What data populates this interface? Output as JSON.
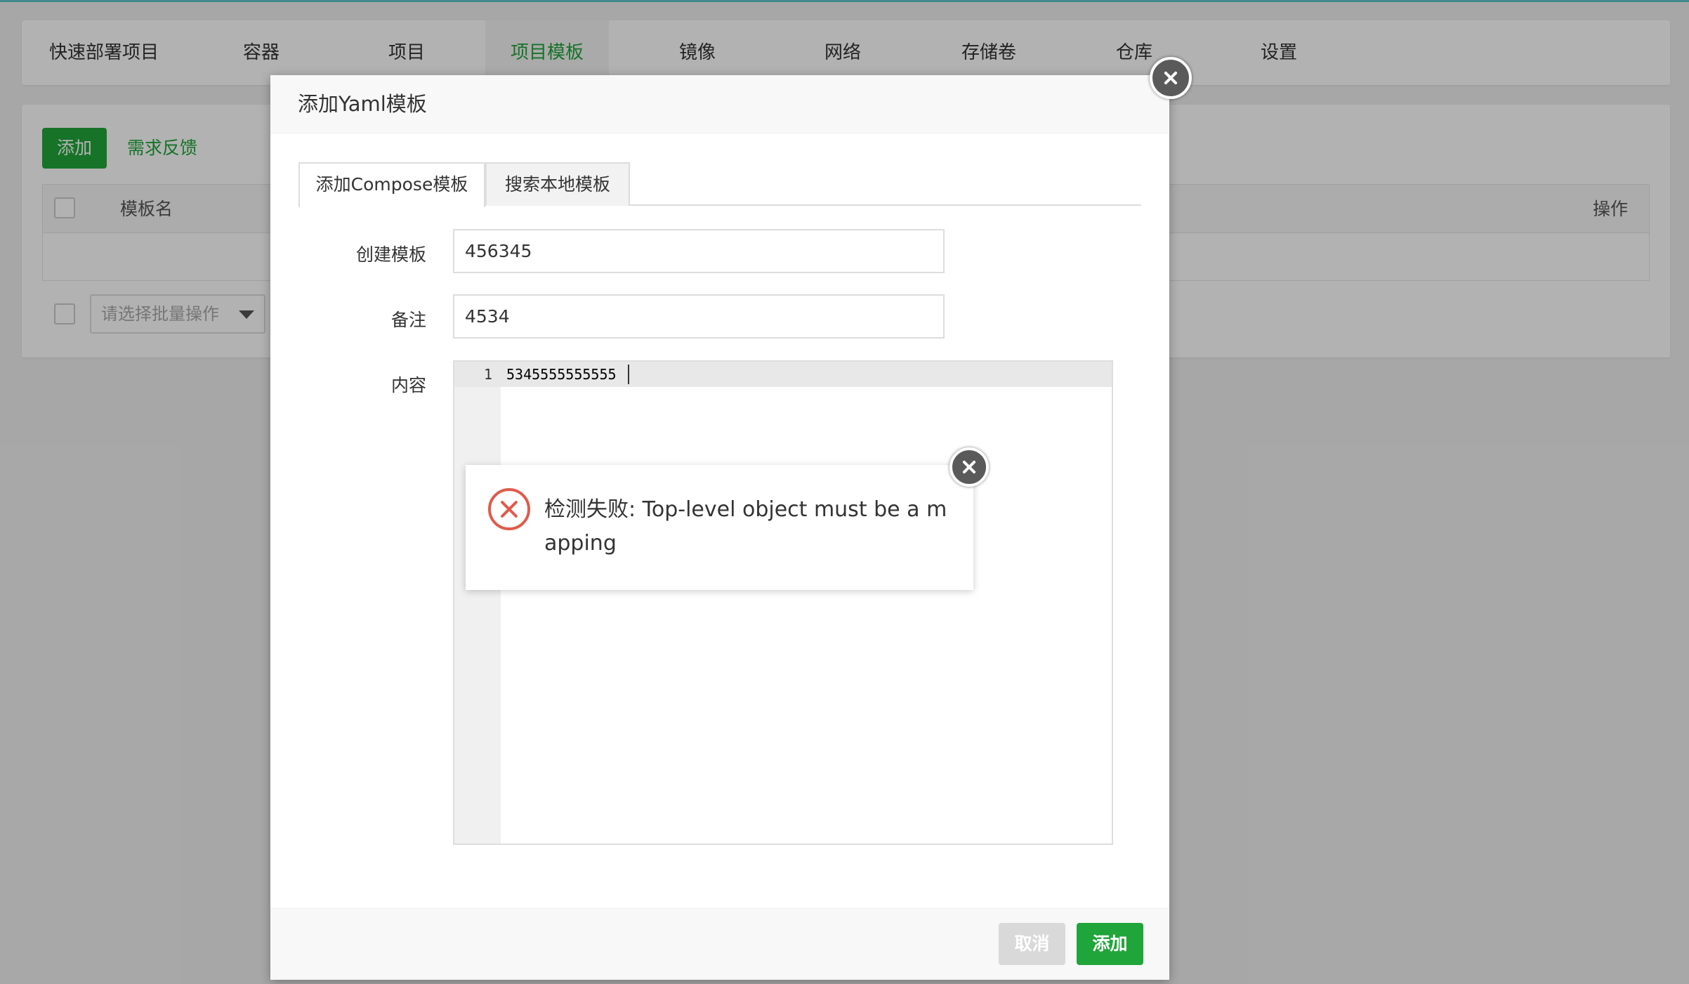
{
  "nav": {
    "items": [
      {
        "label": "快速部署项目"
      },
      {
        "label": "容器"
      },
      {
        "label": "项目"
      },
      {
        "label": "项目模板",
        "active": true
      },
      {
        "label": "镜像"
      },
      {
        "label": "网络"
      },
      {
        "label": "存储卷"
      },
      {
        "label": "仓库"
      },
      {
        "label": "设置"
      }
    ]
  },
  "toolbar": {
    "add_label": "添加",
    "feedback_label": "需求反馈"
  },
  "table": {
    "columns": [
      "模板名",
      "操作"
    ]
  },
  "batch": {
    "placeholder": "请选择批量操作"
  },
  "modal": {
    "title": "添加Yaml模板",
    "tabs": [
      {
        "label": "添加Compose模板",
        "active": true
      },
      {
        "label": "搜索本地模板",
        "active": false
      }
    ],
    "fields": {
      "name_label": "创建模板",
      "name_value": "456345",
      "remark_label": "备注",
      "remark_value": "4534",
      "content_label": "内容"
    },
    "editor": {
      "line_number": "1",
      "code": "5345555555555"
    },
    "footer": {
      "cancel_label": "取消",
      "submit_label": "添加"
    }
  },
  "error": {
    "message": "检测失败: Top-level object must be a mapping"
  },
  "colors": {
    "accent": "#20a53a",
    "error": "#e05b4b",
    "top_line": "#5ec4c8"
  }
}
